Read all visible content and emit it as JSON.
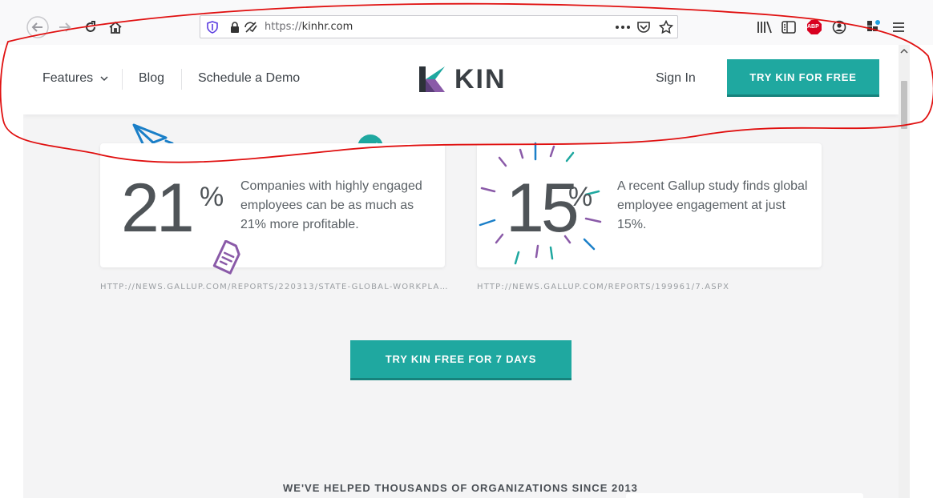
{
  "browser": {
    "url_scheme": "https://",
    "url_host": "kinhr.com",
    "icons": [
      "back-icon",
      "forward-icon",
      "reload-icon",
      "home-icon",
      "shield-icon",
      "lock-icon",
      "tracking-icon",
      "more-icon",
      "pocket-icon",
      "bookmark-star-icon",
      "library-icon",
      "sidebar-icon",
      "adblock-icon",
      "account-icon",
      "extensions-icon",
      "menu-icon"
    ],
    "adblock_label": "ABP"
  },
  "nav": {
    "features": "Features",
    "blog": "Blog",
    "schedule_demo": "Schedule a Demo",
    "logo_text": "KIN",
    "sign_in": "Sign In",
    "cta": "TRY KIN FOR FREE"
  },
  "stats": [
    {
      "number": "21",
      "unit": "%",
      "text": "Companies with highly engaged employees can be as much as 21% more profitable.",
      "source": "HTTP://NEWS.GALLUP.COM/REPORTS/220313/STATE-GLOBAL-WORKPLA…"
    },
    {
      "number": "15",
      "unit": "%",
      "text": "A recent Gallup study finds global employee engagement at just 15%.",
      "source": "HTTP://NEWS.GALLUP.COM/REPORTS/199961/7.ASPX"
    }
  ],
  "cta_trial": "TRY KIN FREE FOR 7 DAYS",
  "section_heading": "WE'VE HELPED THOUSANDS OF ORGANIZATIONS SINCE 2013",
  "colors": {
    "accent": "#1fa8a0",
    "annotation": "#e01010",
    "purple": "#8a5aa8",
    "blue": "#1a7fc8"
  }
}
